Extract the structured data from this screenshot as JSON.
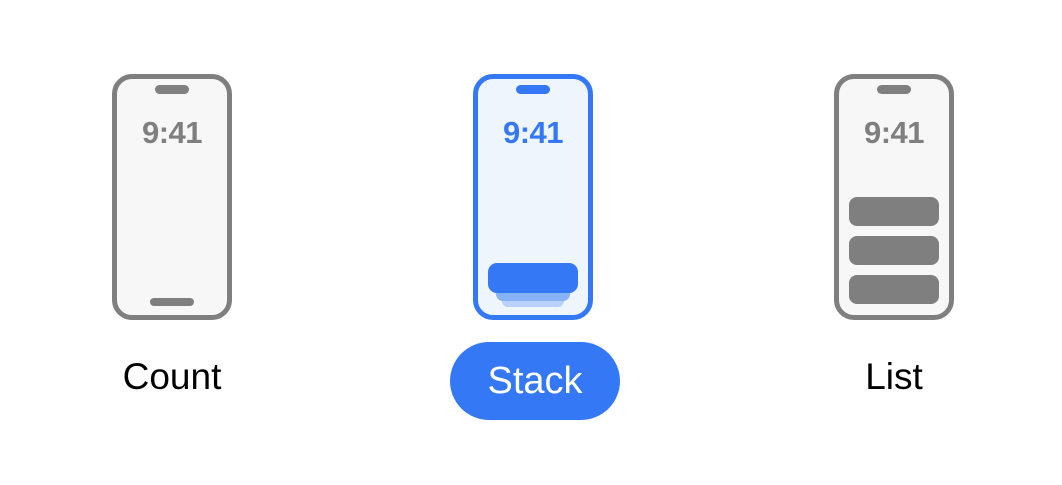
{
  "layout_picker": {
    "options": [
      {
        "id": "count",
        "label": "Count",
        "time": "9:41",
        "selected": false
      },
      {
        "id": "stack",
        "label": "Stack",
        "time": "9:41",
        "selected": true
      },
      {
        "id": "list",
        "label": "List",
        "time": "9:41",
        "selected": false
      }
    ]
  },
  "colors": {
    "accent": "#3478f6",
    "inactive": "#7f7f7f",
    "phone_fill": "#f7f7f7",
    "phone_fill_selected": "#eff5fd",
    "background": "#ffffff"
  },
  "icons": {
    "count": "phone-count-layout-icon",
    "stack": "phone-stack-layout-icon",
    "list": "phone-list-layout-icon"
  }
}
